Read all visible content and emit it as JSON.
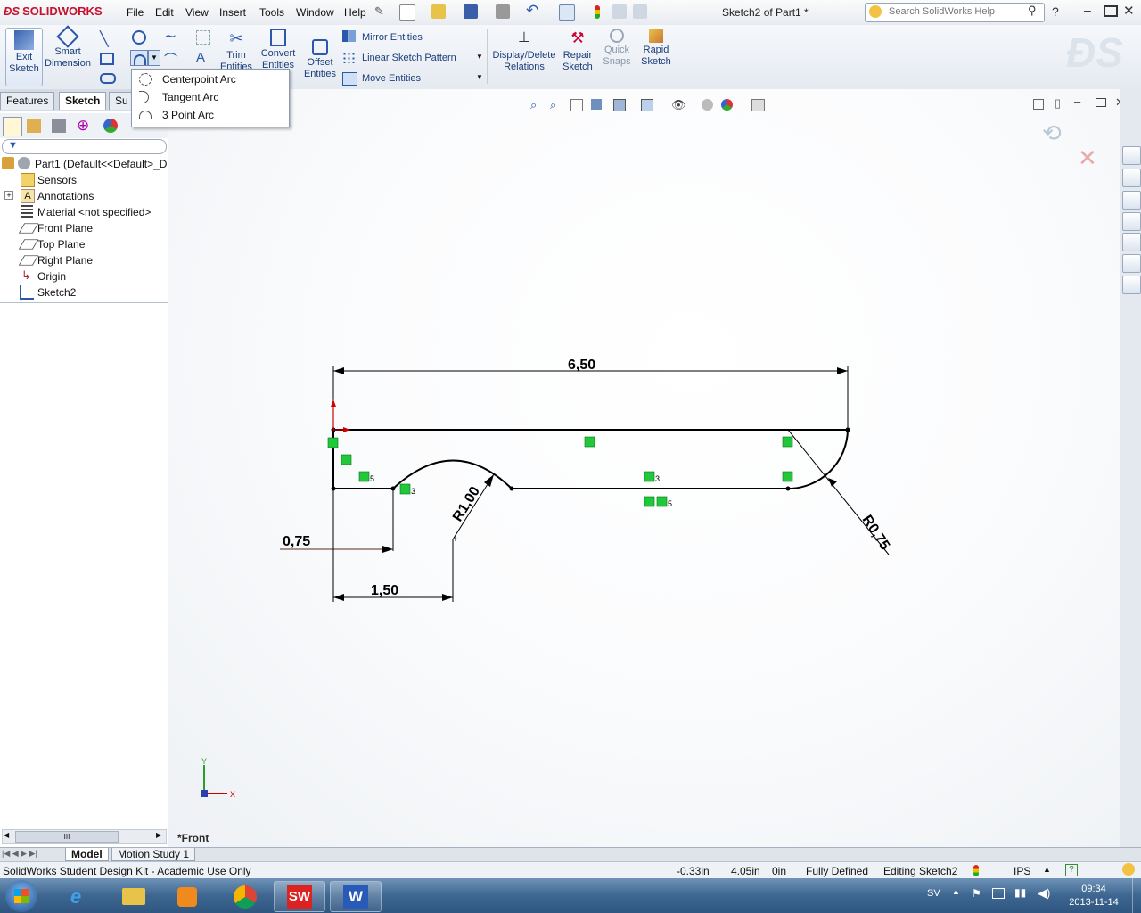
{
  "app": {
    "logo_text": "SOLIDWORKS",
    "doc_title": "Sketch2 of Part1 *",
    "menus": [
      "File",
      "Edit",
      "View",
      "Insert",
      "Tools",
      "Window",
      "Help"
    ],
    "search_placeholder": "Search SolidWorks Help"
  },
  "commandmanager": {
    "exit_sketch": "Exit\nSketch",
    "smart_dimension": "Smart\nDimension",
    "trim_entities": "Trim\nEntities",
    "convert_entities": "Convert\nEntities",
    "offset_entities": "Offset\nEntities",
    "mirror_entities": "Mirror Entities",
    "linear_sketch_pattern": "Linear Sketch Pattern",
    "move_entities": "Move Entities",
    "display_delete_relations": "Display/Delete\nRelations",
    "repair_sketch": "Repair\nSketch",
    "quick_snaps": "Quick\nSnaps",
    "rapid_sketch": "Rapid\nSketch"
  },
  "arc_flyout": {
    "items": [
      "Centerpoint Arc",
      "Tangent Arc",
      "3 Point Arc"
    ]
  },
  "left_panel": {
    "tabs": [
      "Features",
      "Sketch",
      "Su"
    ],
    "tree": [
      {
        "label": "Part1  (Default<<Default>_D",
        "icon": "part-icon"
      },
      {
        "label": "Sensors",
        "icon": "sensors-icon"
      },
      {
        "label": "Annotations",
        "icon": "annotations-icon"
      },
      {
        "label": "Material <not specified>",
        "icon": "material-icon"
      },
      {
        "label": "Front Plane",
        "icon": "plane-icon"
      },
      {
        "label": "Top Plane",
        "icon": "plane-icon"
      },
      {
        "label": "Right Plane",
        "icon": "plane-icon"
      },
      {
        "label": "Origin",
        "icon": "origin-icon"
      },
      {
        "label": "Sketch2",
        "icon": "sketch-icon"
      }
    ],
    "scroll_label": "III"
  },
  "sketch": {
    "dim_overall": "6,50",
    "dim_075": "0,75",
    "dim_150": "1,50",
    "dim_r100": "R1,00",
    "dim_r075": "R0,75",
    "relation_labels": [
      "5",
      "3",
      "3",
      "5"
    ],
    "view_label": "*Front",
    "triad_x": "X",
    "triad_y": "Y"
  },
  "bottom_tabs": [
    "Model",
    "Motion Study 1"
  ],
  "status": {
    "license": "SolidWorks Student Design Kit - Academic Use Only",
    "x": "-0.33in",
    "y": "4.05in",
    "z": "0in",
    "state": "Fully Defined",
    "editing": "Editing Sketch2",
    "units": "IPS"
  },
  "taskbar": {
    "lang": "SV",
    "time": "09:34",
    "date": "2013-11-14"
  },
  "colors": {
    "sketch_line": "#000000",
    "relation_green": "#1fc93a",
    "title_red": "#c8102e",
    "taskbar_blue": "#3d6690"
  }
}
